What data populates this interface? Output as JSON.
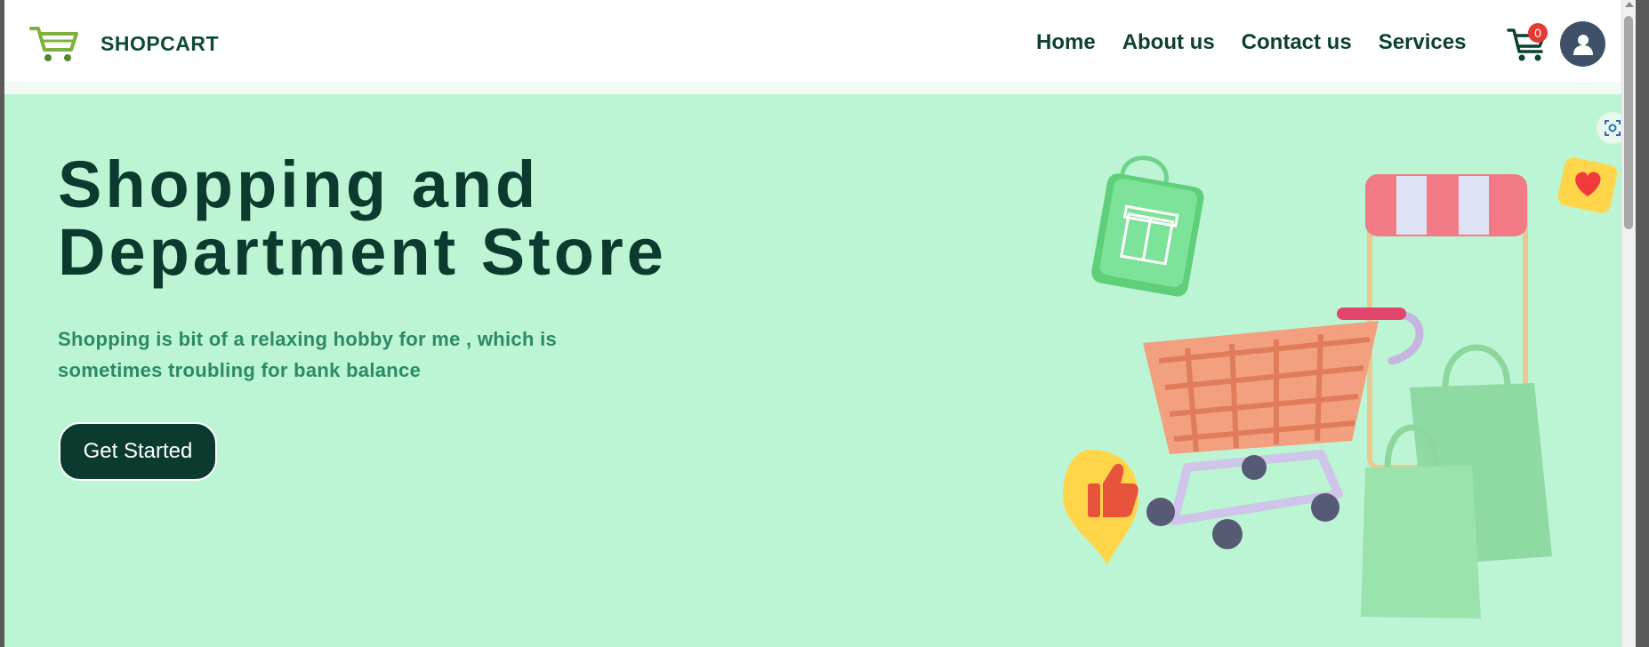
{
  "navbar": {
    "brand_name": "SHOPCART",
    "links": [
      {
        "label": "Home"
      },
      {
        "label": "About us"
      },
      {
        "label": "Contact us"
      },
      {
        "label": "Services"
      }
    ],
    "cart_count": "0"
  },
  "hero": {
    "title": "Shopping and Department Store",
    "subtitle": "Shopping is bit of a relaxing hobby for me , which is sometimes troubling for bank balance",
    "cta_label": "Get Started"
  },
  "icons": {
    "logo": "shopping-cart-logo-icon",
    "cart": "cart-icon",
    "avatar": "user-icon",
    "lens": "visual-search-icon"
  },
  "colors": {
    "brand_dark": "#0b3b2f",
    "hero_bg": "#bcf5d4",
    "subtitle": "#2c8a66",
    "badge": "#e53935",
    "avatar_bg": "#3f5169"
  }
}
